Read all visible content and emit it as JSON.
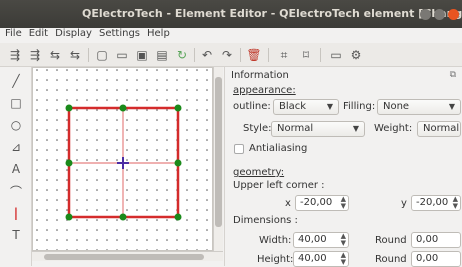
{
  "window": {
    "title": "QElectroTech - Element Editor - QElectroTech element [Changed]"
  },
  "menu": {
    "file": "File",
    "edit": "Edit",
    "display": "Display",
    "settings": "Settings",
    "help": "Help"
  },
  "toolbar": {
    "icons": [
      "align-icon",
      "align-2-icon",
      "flip-icon",
      "flip-2-icon",
      "new-icon",
      "open-icon",
      "save-icon",
      "save-as-icon",
      "reload-icon",
      "undo-icon",
      "redo-icon",
      "delete-icon",
      "zoom-fit-icon",
      "zoom-reset-icon",
      "comment-icon",
      "settings-icon"
    ]
  },
  "tools": [
    "line-tool",
    "rectangle-tool",
    "ellipse-tool",
    "polygon-tool",
    "text-tool",
    "arc-tool",
    "terminal-tool",
    "dynamic-text-tool"
  ],
  "panel": {
    "header": "Information",
    "appearance_label": "appearance:",
    "outline_label": "outline:",
    "outline_value": "Black",
    "filling_label": "Filling:",
    "filling_value": "None",
    "style_label": "Style:",
    "style_value": "Normal",
    "weight_label": "Weight:",
    "weight_value": "Normal",
    "antialiasing_label": "Antialiasing",
    "geometry_label": "geometry:",
    "upper_left_label": "Upper left corner :",
    "x_label": "x",
    "x_value": "-20,00",
    "y_label": "y",
    "y_value": "-20,00",
    "dimensions_label": "Dimensions :",
    "width_label": "Width:",
    "width_value": "40,00",
    "height_label": "Height:",
    "height_value": "40,00",
    "round_label": "Round :",
    "round_w_value": "0,00",
    "round_h_value": "0,00"
  },
  "colors": {
    "shape_red": "#d42b2b",
    "handle_green": "#1a8a1a",
    "origin_cross": "#4b2ca3"
  }
}
